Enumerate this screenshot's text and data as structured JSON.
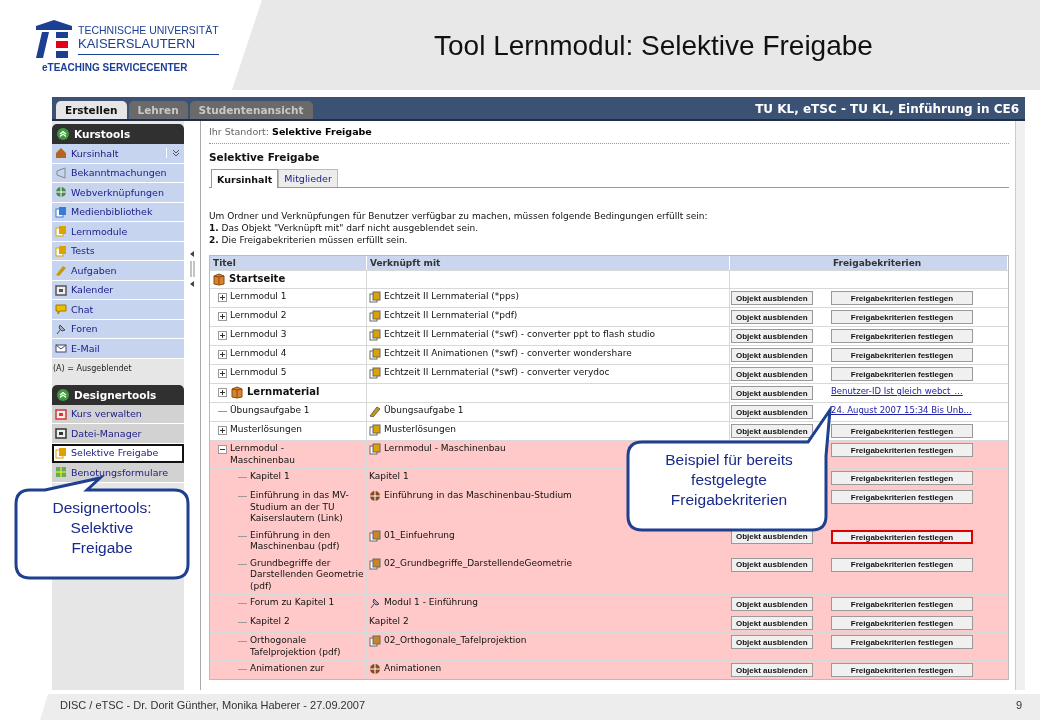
{
  "header": {
    "logo_lines": [
      "TECHNISCHE UNIVERSITÄT",
      "KAISERSLAUTERN",
      "eTEACHING SERVICECENTER"
    ],
    "title": "Tool Lernmodul: Selektive Freigabe"
  },
  "app": {
    "tabs": [
      {
        "label": "Erstellen",
        "selected": true
      },
      {
        "label": "Lehren",
        "selected": false
      },
      {
        "label": "Studentenansicht",
        "selected": false
      }
    ],
    "course_title": "TU KL, eTSC - TU KL, Einführung in CE6",
    "sidebar": {
      "groups": [
        {
          "title": "Kurstools",
          "items": [
            {
              "label": "Kursinhalt",
              "kind": "home",
              "selected": false,
              "dropdown": true
            },
            {
              "label": "Bekanntmachungen",
              "kind": "announce",
              "selected": false
            },
            {
              "label": "Webverknüpfungen",
              "kind": "web",
              "selected": false
            },
            {
              "label": "Medienbibliothek",
              "kind": "media",
              "selected": false
            },
            {
              "label": "Lernmodule",
              "kind": "module",
              "selected": false
            },
            {
              "label": "Tests",
              "kind": "test",
              "selected": false
            },
            {
              "label": "Aufgaben",
              "kind": "task",
              "selected": false
            },
            {
              "label": "Kalender",
              "kind": "calendar",
              "selected": false
            },
            {
              "label": "Chat",
              "kind": "chat",
              "selected": false
            },
            {
              "label": "Foren",
              "kind": "forum",
              "selected": false
            },
            {
              "label": "E-Mail",
              "kind": "mail",
              "selected": false
            }
          ],
          "note": "(A) = Ausgeblendet"
        },
        {
          "title": "Designertools",
          "items": [
            {
              "label": "Kurs verwalten",
              "kind": "manage",
              "selected": false
            },
            {
              "label": "Datei-Manager",
              "kind": "files",
              "selected": false
            },
            {
              "label": "Selektive Freigabe",
              "kind": "release",
              "selected": true
            },
            {
              "label": "Benotungsformulare",
              "kind": "forms",
              "selected": false
            }
          ]
        }
      ]
    },
    "breadcrumb": "Ihr Standort: **Selektive Freigabe**",
    "page_title": "Selektive Freigabe",
    "content_tabs": [
      {
        "label": "Kursinhalt",
        "selected": true
      },
      {
        "label": "Mitglieder",
        "selected": false
      }
    ],
    "intro": [
      "Um Ordner und Verknüpfungen für Benutzer verfügbar zu machen, müssen folgende Bedingungen erfüllt sein:",
      "**1.** Das Objekt \"Verknüpft mit\" darf nicht ausgeblendet sein.",
      "**2.** Die Freigabekriterien müssen erfüllt sein."
    ],
    "table": {
      "columns": [
        "Titel",
        "Verknüpft mit",
        "Freigabekriterien"
      ],
      "rows": [
        {
          "title": "Startseite",
          "kind": "folder",
          "highlighted": false,
          "children": [
            {
              "title": "Lernmodul 1",
              "kind": "module",
              "expanded": false,
              "highlighted": false,
              "link": "Echtzeit II Lernmaterial (*pps)",
              "hide_button": "Objekt ausblenden",
              "criteria": {
                "kind": "button",
                "label": "Freigabekriterien festlegen",
                "outlined": false
              }
            },
            {
              "title": "Lernmodul 2",
              "kind": "module",
              "expanded": false,
              "highlighted": false,
              "link": "Echtzeit II Lernmaterial (*pdf)",
              "hide_button": "Objekt ausblenden",
              "criteria": {
                "kind": "button",
                "label": "Freigabekriterien festlegen",
                "outlined": false
              }
            },
            {
              "title": "Lernmodul 3",
              "kind": "module",
              "expanded": false,
              "highlighted": false,
              "link": "Echtzeit II Lernmaterial (*swf) - converter ppt to flash studio",
              "hide_button": "Objekt ausblenden",
              "criteria": {
                "kind": "button",
                "label": "Freigabekriterien festlegen",
                "outlined": false
              }
            },
            {
              "title": "Lernmodul 4",
              "kind": "module",
              "expanded": false,
              "highlighted": false,
              "link": "Echtzeit II Animationen (*swf) - converter wondershare",
              "hide_button": "Objekt ausblenden",
              "criteria": {
                "kind": "button",
                "label": "Freigabekriterien festlegen",
                "outlined": false
              }
            },
            {
              "title": "Lernmodul 5",
              "kind": "module",
              "expanded": false,
              "highlighted": false,
              "link": "Echtzeit II Lernmaterial (*swf) - converter verydoc",
              "hide_button": "Objekt ausblenden",
              "criteria": {
                "kind": "button",
                "label": "Freigabekriterien festlegen",
                "outlined": false
              }
            },
            {
              "title": "Lernmaterial",
              "kind": "folder",
              "expanded": false,
              "highlighted": false,
              "hide_button": "Objekt ausblenden",
              "criteria": {
                "kind": "link",
                "label": "Benutzer-ID Ist gleich webct_..."
              }
            },
            {
              "title": "Übungsaufgabe 1",
              "kind": "assignment",
              "highlighted": false,
              "link": "Übungsaufgabe 1",
              "hide_button": "Objekt ausblenden",
              "criteria": {
                "kind": "link",
                "label": "24. August 2007 15:34 Bis Unb..."
              }
            },
            {
              "title": "Musterlösungen",
              "kind": "module",
              "expanded": false,
              "highlighted": false,
              "link": "Musterlösungen",
              "hide_button": "Objekt ausblenden",
              "criteria": {
                "kind": "button",
                "label": "Freigabekriterien festlegen",
                "outlined": false
              }
            },
            {
              "title": "Lernmodul - Maschinenbau",
              "kind": "module",
              "expanded": true,
              "highlighted": true,
              "link": "Lernmodul - Maschinenbau",
              "criteria": {
                "kind": "button",
                "label": "Freigabekriterien festlegen",
                "outlined": false
              },
              "children": [
                {
                  "title": "Kapitel 1",
                  "kind": "chapter",
                  "link": "Kapitel 1",
                  "criteria": {
                    "kind": "button",
                    "label": "Freigabekriterien festlegen",
                    "outlined": false
                  }
                },
                {
                  "title": "Einführung in das MV-Studium an der TU Kaiserslautern (Link)",
                  "kind": "web",
                  "link": "Einführung in das Maschinenbau-Studium",
                  "criteria": {
                    "kind": "button",
                    "label": "Freigabekriterien festlegen",
                    "outlined": false
                  }
                },
                {
                  "title": "Einführung in den Maschinenbau (pdf)",
                  "kind": "file",
                  "link": "01_Einfuehrung",
                  "hide_button": "Objekt ausblenden",
                  "criteria": {
                    "kind": "button",
                    "label": "Freigabekriterien festlegen",
                    "outlined": true
                  }
                },
                {
                  "title": "Grundbegriffe der Darstellenden Geometrie (pdf)",
                  "kind": "file",
                  "link": "02_Grundbegriffe_DarstellendeGeometrie",
                  "hide_button": "Objekt ausblenden",
                  "criteria": {
                    "kind": "button",
                    "label": "Freigabekriterien festlegen",
                    "outlined": false
                  }
                },
                {
                  "title": "Forum zu Kapitel 1",
                  "kind": "forum",
                  "link": "Modul 1 - Einführung",
                  "hide_button": "Objekt ausblenden",
                  "criteria": {
                    "kind": "button",
                    "label": "Freigabekriterien festlegen",
                    "outlined": false
                  }
                },
                {
                  "title": "Kapitel 2",
                  "kind": "chapter",
                  "link": "Kapitel 2",
                  "hide_button": "Objekt ausblenden",
                  "criteria": {
                    "kind": "button",
                    "label": "Freigabekriterien festlegen",
                    "outlined": false
                  }
                },
                {
                  "title": "Orthogonale Tafelprojektion (pdf)",
                  "kind": "file",
                  "link": "02_Orthogonale_Tafelprojektion",
                  "hide_button": "Objekt ausblenden",
                  "criteria": {
                    "kind": "button",
                    "label": "Freigabekriterien festlegen",
                    "outlined": false
                  }
                },
                {
                  "title": "Animationen zur",
                  "kind": "web",
                  "link": "Animationen",
                  "hide_button": "Objekt ausblenden",
                  "criteria": {
                    "kind": "button",
                    "label": "Freigabekriterien festlegen",
                    "outlined": false
                  }
                }
              ]
            }
          ]
        }
      ]
    }
  },
  "callouts": [
    {
      "text": "Designertools: Selektive Freigabe"
    },
    {
      "text": "Beispiel für bereits festgelegte Freigabekriterien"
    }
  ],
  "footer": {
    "text": "DISC / eTSC - Dr. Dorit Günther, Monika Haberer - 27.09.2007",
    "page": "9"
  }
}
